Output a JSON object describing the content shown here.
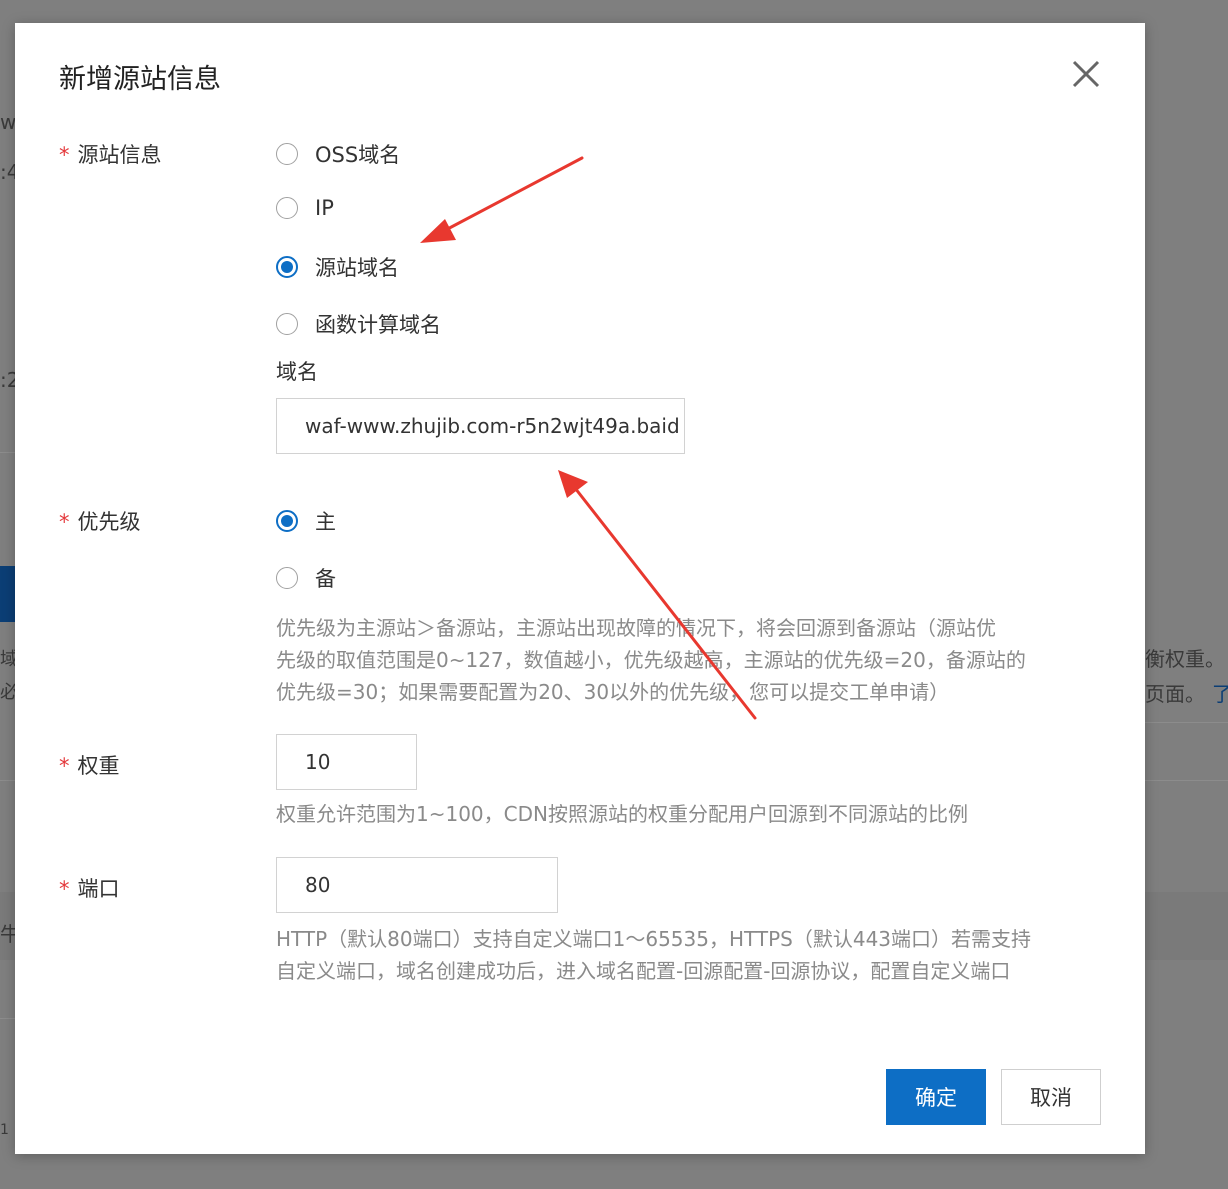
{
  "background": {
    "fragments": [
      "w",
      ":4",
      ":2",
      "域",
      "必",
      "牛",
      "衡权重。",
      "页面。",
      "了",
      "1"
    ]
  },
  "dialog": {
    "title": "新增源站信息",
    "close_icon": "close-icon"
  },
  "origin_info": {
    "label": "源站信息",
    "required_mark": "*",
    "options": [
      "OSS域名",
      "IP",
      "源站域名",
      "函数计算域名"
    ],
    "selected": "源站域名",
    "domain_label": "域名",
    "domain_value": "waf-www.zhujib.com-r5n2wjt49a.baid"
  },
  "priority": {
    "label": "优先级",
    "required_mark": "*",
    "options": [
      "主",
      "备"
    ],
    "selected": "主",
    "help_lines": [
      "优先级为主源站＞备源站，主源站出现故障的情况下，将会回源到备源站（源站优",
      "先级的取值范围是0~127，数值越小，优先级越高，主源站的优先级=20，备源站的",
      "优先级=30；如果需要配置为20、30以外的优先级，您可以提交工单申请）"
    ]
  },
  "weight": {
    "label": "权重",
    "required_mark": "*",
    "value": "10",
    "help": "权重允许范围为1~100，CDN按照源站的权重分配用户回源到不同源站的比例"
  },
  "port": {
    "label": "端口",
    "required_mark": "*",
    "value": "80",
    "help_lines": [
      "HTTP（默认80端口）支持自定义端口1～65535，HTTPS（默认443端口）若需支持",
      "自定义端口，域名创建成功后，进入域名配置-回源配置-回源协议，配置自定义端口"
    ]
  },
  "footer": {
    "ok_label": "确定",
    "cancel_label": "取消"
  },
  "colors": {
    "primary": "#0d6ec5",
    "required": "#e4393c",
    "annotation_arrow": "#e8382f",
    "overlay": "#7f7f7f"
  }
}
